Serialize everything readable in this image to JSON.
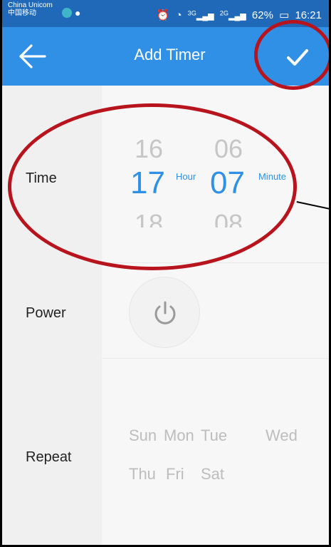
{
  "status_bar": {
    "carrier_line1": "China Unicom",
    "carrier_line2": "中国移动",
    "network1": "3G",
    "network2": "2G",
    "battery": "62%",
    "time": "16:21"
  },
  "header": {
    "title": "Add Timer",
    "back_icon": "arrow-left-icon",
    "confirm_icon": "checkmark-icon"
  },
  "rows": {
    "time_label": "Time",
    "power_label": "Power",
    "repeat_label": "Repeat"
  },
  "time_picker": {
    "hour_prev": "16",
    "hour_selected": "17",
    "hour_next": "18",
    "hour_unit": "Hour",
    "minute_prev": "06",
    "minute_selected": "07",
    "minute_next": "08",
    "minute_unit": "Minute"
  },
  "power": {
    "icon": "power-icon"
  },
  "repeat_days": [
    "Sun",
    "Mon",
    "Tue",
    "Wed",
    "Thu",
    "Fri",
    "Sat"
  ],
  "colors": {
    "accent": "#2f90e6",
    "status_bar": "#1f69b8",
    "annotation": "#b8141d"
  }
}
